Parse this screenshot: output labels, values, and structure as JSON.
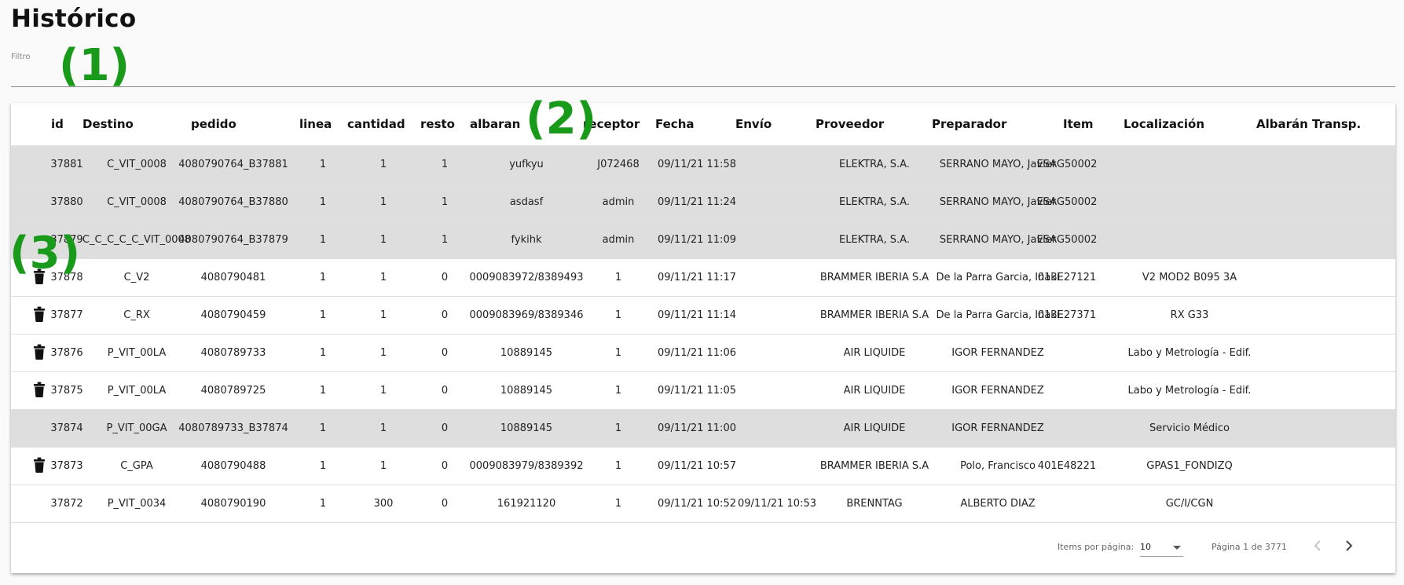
{
  "page": {
    "title": "Histórico"
  },
  "filter": {
    "label": "Filtro",
    "value": ""
  },
  "markers": [
    "(1)",
    "(2)",
    "(3)"
  ],
  "columns": [
    "id",
    "Destino",
    "pedido",
    "linea",
    "cantidad",
    "resto",
    "albaran",
    "receptor",
    "Fecha",
    "Envío",
    "Proveedor",
    "Preparador",
    "Item",
    "Localización",
    "Albarán Transp."
  ],
  "rows": [
    {
      "grey": true,
      "trash": false,
      "id": "37881",
      "destino": "C_VIT_0008",
      "pedido": "4080790764_B37881",
      "linea": "1",
      "cantidad": "1",
      "resto": "1",
      "albaran": "yufkyu",
      "receptor": "J072468",
      "fecha": "09/11/21 11:58",
      "envio": "",
      "proveedor": "ELEKTRA, S.A.",
      "preparador": "SERRANO MAYO, Javier",
      "item": "ESAG50002",
      "localizacion": "",
      "albaran_transp": ""
    },
    {
      "grey": true,
      "trash": false,
      "id": "37880",
      "destino": "C_VIT_0008",
      "pedido": "4080790764_B37880",
      "linea": "1",
      "cantidad": "1",
      "resto": "1",
      "albaran": "asdasf",
      "receptor": "admin",
      "fecha": "09/11/21 11:24",
      "envio": "",
      "proveedor": "ELEKTRA, S.A.",
      "preparador": "SERRANO MAYO, Javier",
      "item": "ESAG50002",
      "localizacion": "",
      "albaran_transp": ""
    },
    {
      "grey": true,
      "trash": false,
      "id": "37879",
      "destino": "C_C_C_C_C_VIT_0008",
      "pedido": "4080790764_B37879",
      "linea": "1",
      "cantidad": "1",
      "resto": "1",
      "albaran": "fykihk",
      "receptor": "admin",
      "fecha": "09/11/21 11:09",
      "envio": "",
      "proveedor": "ELEKTRA, S.A.",
      "preparador": "SERRANO MAYO, Javier",
      "item": "ESAG50002",
      "localizacion": "",
      "albaran_transp": ""
    },
    {
      "grey": false,
      "trash": true,
      "id": "37878",
      "destino": "C_V2",
      "pedido": "4080790481",
      "linea": "1",
      "cantidad": "1",
      "resto": "0",
      "albaran": "0009083972/8389493",
      "receptor": "1",
      "fecha": "09/11/21 11:17",
      "envio": "",
      "proveedor": "BRAMMER IBERIA S.A",
      "preparador": "De la Parra Garcia, Iñaki",
      "item": "013E27121",
      "localizacion": "V2 MOD2 B095 3A",
      "albaran_transp": ""
    },
    {
      "grey": false,
      "trash": true,
      "id": "37877",
      "destino": "C_RX",
      "pedido": "4080790459",
      "linea": "1",
      "cantidad": "1",
      "resto": "0",
      "albaran": "0009083969/8389346",
      "receptor": "1",
      "fecha": "09/11/21 11:14",
      "envio": "",
      "proveedor": "BRAMMER IBERIA S.A",
      "preparador": "De la Parra Garcia, Iñaki",
      "item": "013E27371",
      "localizacion": "RX G33",
      "albaran_transp": ""
    },
    {
      "grey": false,
      "trash": true,
      "id": "37876",
      "destino": "P_VIT_00LA",
      "pedido": "4080789733",
      "linea": "1",
      "cantidad": "1",
      "resto": "0",
      "albaran": "10889145",
      "receptor": "1",
      "fecha": "09/11/21 11:06",
      "envio": "",
      "proveedor": "AIR LIQUIDE",
      "preparador": "IGOR FERNANDEZ",
      "item": "",
      "localizacion": "Labo y Metrología - Edif.",
      "albaran_transp": ""
    },
    {
      "grey": false,
      "trash": true,
      "id": "37875",
      "destino": "P_VIT_00LA",
      "pedido": "4080789725",
      "linea": "1",
      "cantidad": "1",
      "resto": "0",
      "albaran": "10889145",
      "receptor": "1",
      "fecha": "09/11/21 11:05",
      "envio": "",
      "proveedor": "AIR LIQUIDE",
      "preparador": "IGOR FERNANDEZ",
      "item": "",
      "localizacion": "Labo y Metrología - Edif.",
      "albaran_transp": ""
    },
    {
      "grey": true,
      "trash": false,
      "id": "37874",
      "destino": "P_VIT_00GA",
      "pedido": "4080789733_B37874",
      "linea": "1",
      "cantidad": "1",
      "resto": "0",
      "albaran": "10889145",
      "receptor": "1",
      "fecha": "09/11/21 11:00",
      "envio": "",
      "proveedor": "AIR LIQUIDE",
      "preparador": "IGOR FERNANDEZ",
      "item": "",
      "localizacion": "Servicio Médico",
      "albaran_transp": ""
    },
    {
      "grey": false,
      "trash": true,
      "id": "37873",
      "destino": "C_GPA",
      "pedido": "4080790488",
      "linea": "1",
      "cantidad": "1",
      "resto": "0",
      "albaran": "0009083979/8389392",
      "receptor": "1",
      "fecha": "09/11/21 10:57",
      "envio": "",
      "proveedor": "BRAMMER IBERIA S.A",
      "preparador": "Polo, Francisco",
      "item": "401E48221",
      "localizacion": "GPAS1_FONDIZQ",
      "albaran_transp": ""
    },
    {
      "grey": false,
      "trash": false,
      "id": "37872",
      "destino": "P_VIT_0034",
      "pedido": "4080790190",
      "linea": "1",
      "cantidad": "300",
      "resto": "0",
      "albaran": "161921120",
      "receptor": "1",
      "fecha": "09/11/21 10:52",
      "envio": "09/11/21 10:53",
      "proveedor": "BRENNTAG",
      "preparador": "ALBERTO DIAZ",
      "item": "",
      "localizacion": "GC/I/CGN",
      "albaran_transp": ""
    }
  ],
  "paginator": {
    "items_label": "Items por página:",
    "page_size": "10",
    "range_label": "Página 1 de 3771",
    "prev_icon": "chevron-left-icon",
    "next_icon": "chevron-right-icon"
  },
  "colors": {
    "grey_row": "#dedede",
    "marker": "#1a9a1a"
  }
}
